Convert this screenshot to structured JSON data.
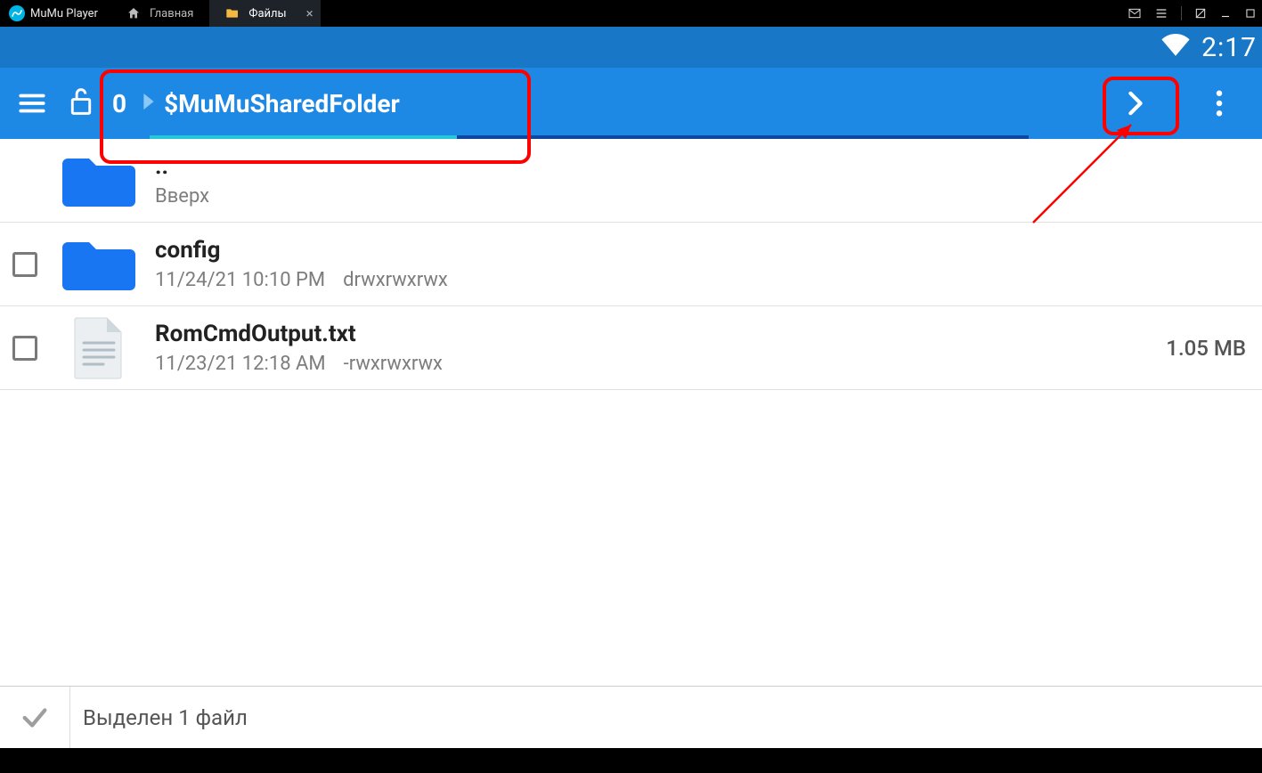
{
  "mumu": {
    "brand": "MuMu Player",
    "tab_home_label": "Главная",
    "tab_files_label": "Файлы"
  },
  "status": {
    "time": "2:17"
  },
  "appbar": {
    "root_label": "0",
    "folder": "$MuMuSharedFolder",
    "progress_percent": 35
  },
  "files": [
    {
      "kind": "up",
      "name": "..",
      "sub": "Вверх"
    },
    {
      "kind": "folder",
      "name": "config",
      "date": "11/24/21 10:10 PM",
      "perms": "drwxrwxrwx"
    },
    {
      "kind": "file",
      "name": "RomCmdOutput.txt",
      "date": "11/23/21 12:18 AM",
      "perms": "-rwxrwxrwx",
      "size": "1.05 MB"
    }
  ],
  "clipboard": {
    "text": "Выделен 1 файл"
  },
  "colors": {
    "primary": "#1e88e5",
    "status_blue": "#1878c7",
    "folder_blue": "#1976f2",
    "highlight_red": "#ff0000"
  }
}
